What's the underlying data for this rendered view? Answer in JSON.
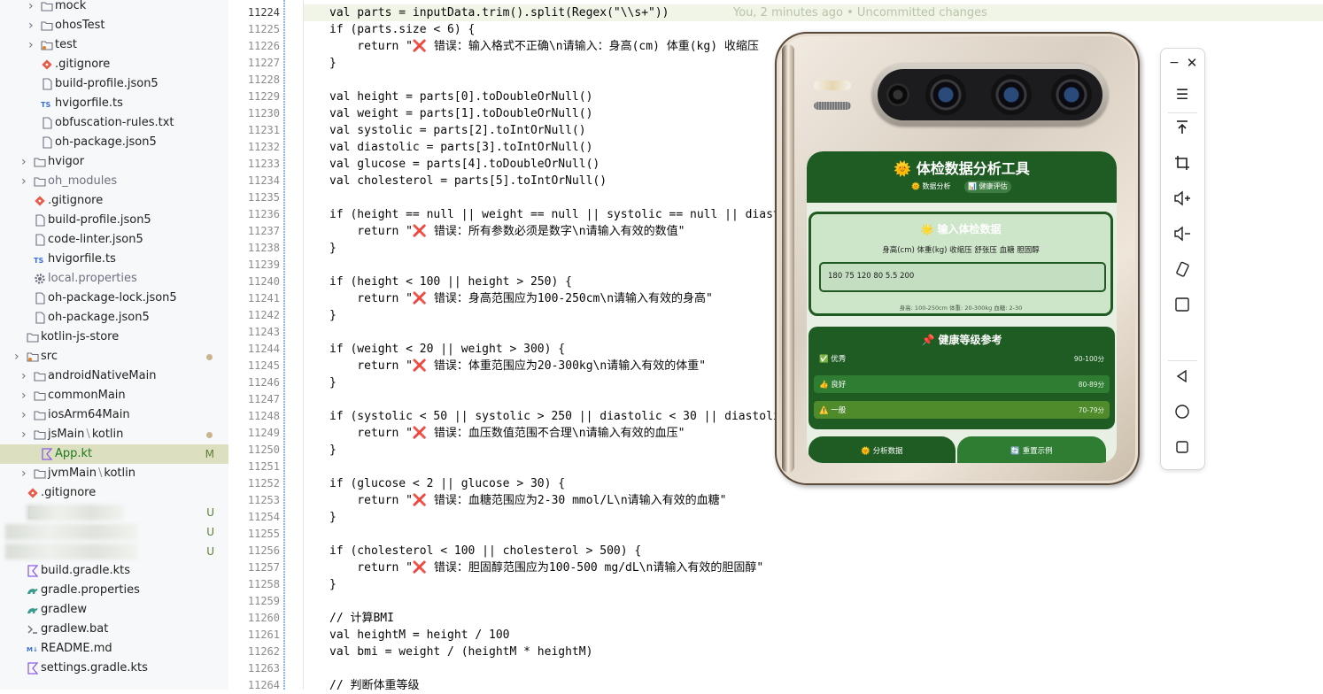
{
  "file_tree": {
    "items": [
      {
        "label": "mock",
        "kind": "folder",
        "indent": 2,
        "chevron": true
      },
      {
        "label": "ohosTest",
        "kind": "folder",
        "indent": 2,
        "chevron": true
      },
      {
        "label": "test",
        "kind": "folder-test",
        "indent": 2,
        "chevron": true
      },
      {
        "label": ".gitignore",
        "kind": "git",
        "indent": 2
      },
      {
        "label": "build-profile.json5",
        "kind": "file",
        "indent": 2
      },
      {
        "label": "hvigorfile.ts",
        "kind": "ts",
        "indent": 2
      },
      {
        "label": "obfuscation-rules.txt",
        "kind": "file",
        "indent": 2
      },
      {
        "label": "oh-package.json5",
        "kind": "file",
        "indent": 2
      },
      {
        "label": "hvigor",
        "kind": "folder",
        "indent": 1,
        "chevron": true
      },
      {
        "label": "oh_modules",
        "kind": "folder",
        "indent": 1,
        "chevron": true,
        "dim": true
      },
      {
        "label": ".gitignore",
        "kind": "git",
        "indent": 1
      },
      {
        "label": "build-profile.json5",
        "kind": "file",
        "indent": 1
      },
      {
        "label": "code-linter.json5",
        "kind": "file",
        "indent": 1
      },
      {
        "label": "hvigorfile.ts",
        "kind": "ts",
        "indent": 1
      },
      {
        "label": "local.properties",
        "kind": "gear",
        "indent": 1,
        "dim": true
      },
      {
        "label": "oh-package-lock.json5",
        "kind": "file",
        "indent": 1
      },
      {
        "label": "oh-package.json5",
        "kind": "file",
        "indent": 1
      },
      {
        "label": "kotlin-js-store",
        "kind": "folder",
        "indent": 0
      },
      {
        "label": "src",
        "kind": "folder-src",
        "indent": 0,
        "chevron": true,
        "dot": true
      },
      {
        "label": "androidNativeMain",
        "kind": "folder",
        "indent": 1,
        "chevron": true
      },
      {
        "label": "commonMain",
        "kind": "folder",
        "indent": 1,
        "chevron": true
      },
      {
        "label": "iosArm64Main",
        "kind": "folder",
        "indent": 1,
        "chevron": true
      },
      {
        "label": "jsMain",
        "suffix": "kotlin",
        "kind": "folder",
        "indent": 1,
        "chevron": true,
        "dot": true
      },
      {
        "label": "App.kt",
        "kind": "kotlin",
        "indent": 2,
        "selected": true,
        "badge": "M"
      },
      {
        "label": "jvmMain",
        "suffix": "kotlin",
        "kind": "folder",
        "indent": 1,
        "chevron": true
      },
      {
        "label": ".gitignore",
        "kind": "git",
        "indent": 0
      },
      {
        "label": "",
        "kind": "file",
        "indent": 0,
        "blurred": true,
        "badge": "U"
      },
      {
        "label": "",
        "kind": "none",
        "indent": 0,
        "blurred": true,
        "badge": "U"
      },
      {
        "label": "",
        "kind": "none",
        "indent": 0,
        "blurred": true,
        "badge": "U"
      },
      {
        "label": "build.gradle.kts",
        "kind": "kotlin",
        "indent": 0
      },
      {
        "label": "gradle.properties",
        "kind": "gradle",
        "indent": 0
      },
      {
        "label": "gradlew",
        "kind": "gradle",
        "indent": 0
      },
      {
        "label": "gradlew.bat",
        "kind": "terminal",
        "indent": 0
      },
      {
        "label": "README.md",
        "kind": "md",
        "indent": 0
      },
      {
        "label": "settings.gradle.kts",
        "kind": "kotlin",
        "indent": 0
      }
    ]
  },
  "editor": {
    "first_line": 11224,
    "blame": "You, 2 minutes ago • Uncommitted changes",
    "lines": [
      "val parts = inputData.trim().split(Regex(\"\\\\s+\"))",
      "if (parts.size < 6) {",
      "    return \"❌ 错误：输入格式不正确\\n请输入：身高(cm) 体重(kg) 收缩压",
      "}",
      "",
      "val height = parts[0].toDoubleOrNull()",
      "val weight = parts[1].toDoubleOrNull()",
      "val systolic = parts[2].toIntOrNull()",
      "val diastolic = parts[3].toIntOrNull()",
      "val glucose = parts[4].toDoubleOrNull()",
      "val cholesterol = parts[5].toIntOrNull()",
      "",
      "if (height == null || weight == null || systolic == null || diast                                   ) {",
      "    return \"❌ 错误：所有参数必须是数字\\n请输入有效的数值\"",
      "}",
      "",
      "if (height < 100 || height > 250) {",
      "    return \"❌ 错误：身高范围应为100-250cm\\n请输入有效的身高\"",
      "}",
      "",
      "if (weight < 20 || weight > 300) {",
      "    return \"❌ 错误：体重范围应为20-300kg\\n请输入有效的体重\"",
      "}",
      "",
      "if (systolic < 50 || systolic > 250 || diastolic < 30 || diastoli",
      "    return \"❌ 错误：血压数值范围不合理\\n请输入有效的血压\"",
      "}",
      "",
      "if (glucose < 2 || glucose > 30) {",
      "    return \"❌ 错误：血糖范围应为2-30 mmol/L\\n请输入有效的血糖\"",
      "}",
      "",
      "if (cholesterol < 100 || cholesterol > 500) {",
      "    return \"❌ 错误：胆固醇范围应为100-500 mg/dL\\n请输入有效的胆固醇\"",
      "}",
      "",
      "// 计算BMI",
      "val heightM = height / 100",
      "val bmi = weight / (heightM * heightM)",
      "",
      "// 判断体重等级"
    ]
  },
  "app": {
    "title": "🌞 体检数据分析工具",
    "tabs": [
      "🌞 数据分析",
      "📊 健康评估"
    ],
    "input_card": {
      "title": "🌟 输入体检数据",
      "fields": "身高(cm) 体重(kg) 收缩压 舒张压 血糖 胆固醇",
      "value": "180 75 120 80 5.5 200",
      "hint": "身高: 100-250cm  体重: 20-300kg  血糖: 2-30"
    },
    "levels_card": {
      "title": "📌 健康等级参考",
      "levels": [
        {
          "name": "✅ 优秀",
          "range": "90-100分",
          "color": "#1f5c24"
        },
        {
          "name": "👍 良好",
          "range": "80-89分",
          "color": "#2e7d32"
        },
        {
          "name": "⚠️ 一般",
          "range": "70-79分",
          "color": "#4f8a2b"
        }
      ]
    },
    "buttons": [
      "🌞 分析数据",
      "🔄 重置示例"
    ]
  },
  "colors": {
    "app_green": "#1f5c24",
    "selected_row": "#dcdfc0",
    "current_line": "#f0f5e8"
  },
  "toolbar_icons": [
    "minimize-icon",
    "close-icon",
    "menu-icon",
    "pin-top-icon",
    "crop-icon",
    "volume-up-icon",
    "volume-down-icon",
    "rotate-icon",
    "fullscreen-icon",
    "back-icon",
    "home-icon",
    "recents-icon"
  ]
}
